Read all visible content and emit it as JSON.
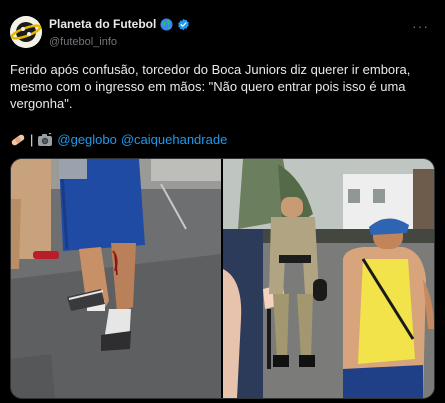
{
  "tweet": {
    "author_name": "Planeta do Futebol",
    "author_handle": "@futebol_info",
    "text": "Ferido após confusão, torcedor do Boca Juniors diz querer ir embora, mesmo com o ingresso em mãos: \"Não quero entrar pois isso é uma vergonha\".",
    "credit_separator": "|",
    "mentions": [
      "@geglobo",
      "@caiquehandrade"
    ]
  },
  "colors": {
    "background": "#000000",
    "text": "#e7e9ea",
    "secondary": "#71767b",
    "accent": "#1d9bf0"
  },
  "icons": {
    "globe": "globe-emoji-icon",
    "verified": "verified-badge-icon",
    "more": "more-options-icon",
    "bandage": "bandage-emoji-icon",
    "camera": "camera-emoji-icon"
  }
}
